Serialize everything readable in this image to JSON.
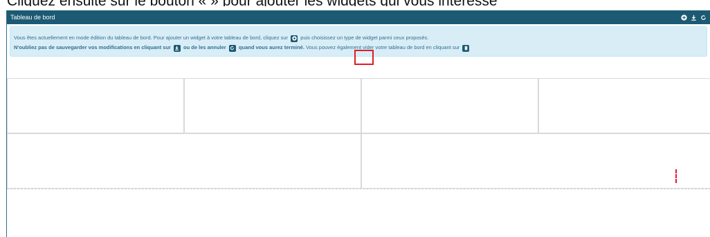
{
  "caption": "Cliquez ensuite sur le bouton « » pour ajouter les widgets qui vous intéresse",
  "header": {
    "title": "Tableau de bord",
    "icons": [
      "plus-circle-icon",
      "download-icon",
      "refresh-icon"
    ]
  },
  "info": {
    "line1_a": "Vous êtes actuellement en mode édition du tableau de bord. Pour ajouter un widget à votre tableau de bord, cliquez sur",
    "line1_b": "puis choisissez un type de widget parmi ceux proposés.",
    "line2_a": "N'oubliez pas de sauvegarder vos modifications en cliquant sur",
    "line2_b": "ou de les annuler",
    "line2_c": "quand vous aurez terminé.",
    "line2_d": "Vous pouvez également vider votre tableau de bord en cliquant sur"
  },
  "colors": {
    "header": "#1c5a73",
    "alert_bg": "#d9edf7",
    "alert_text": "#31708f",
    "highlight": "#e01b24"
  }
}
